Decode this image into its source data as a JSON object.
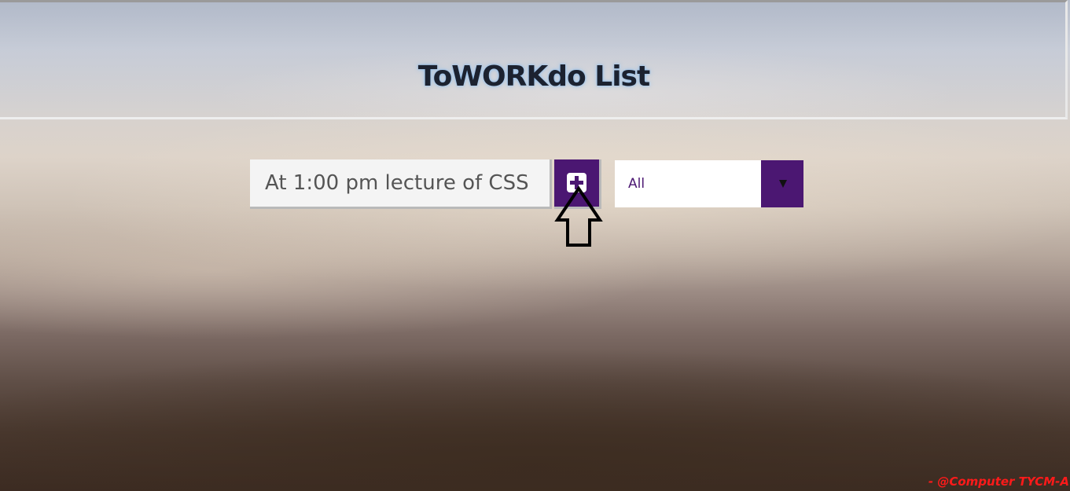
{
  "header": {
    "title": "ToWORKdo List"
  },
  "todo_form": {
    "input_value": "At 1:00 pm lecture of CSS",
    "add_button_icon": "plus-square-icon",
    "filter": {
      "selected": "All",
      "dropdown_icon": "chevron-down-icon"
    }
  },
  "annotation": {
    "arrow_icon": "up-arrow-icon",
    "credit": "- @Computer TYCM-A"
  },
  "colors": {
    "accent": "#4b1772",
    "title_text": "#1c2230",
    "credit_text": "#ff1a1a"
  }
}
